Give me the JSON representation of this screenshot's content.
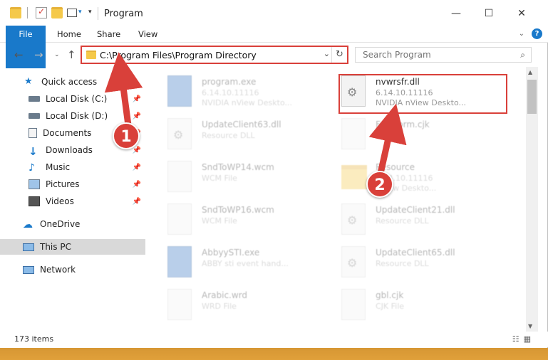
{
  "window": {
    "title": "Program"
  },
  "ribbon": {
    "tabs": [
      "File",
      "Home",
      "Share",
      "View"
    ]
  },
  "address": {
    "path": "C:\\Program Files\\Program Directory"
  },
  "search": {
    "placeholder": "Search Program"
  },
  "nav": {
    "items": [
      {
        "label": "Quick access",
        "icon": "star-icon"
      },
      {
        "label": "Local Disk (C:)",
        "icon": "drive-icon",
        "pinned": true
      },
      {
        "label": "Local Disk (D:)",
        "icon": "drive-icon",
        "pinned": true
      },
      {
        "label": "Documents",
        "icon": "documents-icon",
        "pinned": true
      },
      {
        "label": "Downloads",
        "icon": "downloads-icon",
        "pinned": true
      },
      {
        "label": "Music",
        "icon": "music-icon",
        "pinned": true
      },
      {
        "label": "Pictures",
        "icon": "pictures-icon",
        "pinned": true
      },
      {
        "label": "Videos",
        "icon": "videos-icon",
        "pinned": true
      },
      {
        "label": "OneDrive",
        "icon": "cloud-icon"
      },
      {
        "label": "This PC",
        "icon": "computer-icon",
        "selected": true
      },
      {
        "label": "Network",
        "icon": "network-icon"
      }
    ]
  },
  "files": [
    {
      "name": "program.exe",
      "line2": "6.14.10.11116",
      "line3": "NVIDIA nView Deskto...",
      "icon": "exe-icon",
      "faded": true
    },
    {
      "name": "nvwrsfr.dll",
      "line2": "6.14.10.11116",
      "line3": "NVIDIA nView Deskto...",
      "icon": "dll-gear-icon",
      "faded": false
    },
    {
      "name": "UpdateClient63.dll",
      "line2": "Resource DLL",
      "line3": "",
      "icon": "dll-gear-icon",
      "faded": true
    },
    {
      "name": "Fakeform.cjk",
      "line2": "",
      "line3": "",
      "icon": "file-icon",
      "faded": true
    },
    {
      "name": "SndToWP14.wcm",
      "line2": "WCM File",
      "line3": "",
      "icon": "file-icon",
      "faded": true
    },
    {
      "name": "Resource",
      "line2": "6.14.10.11116",
      "line3": "nView Deskto...",
      "icon": "folder-icon",
      "faded": true
    },
    {
      "name": "SndToWP16.wcm",
      "line2": "WCM File",
      "line3": "",
      "icon": "file-icon",
      "faded": true
    },
    {
      "name": "UpdateClient21.dll",
      "line2": "Resource DLL",
      "line3": "",
      "icon": "dll-gear-icon",
      "faded": true
    },
    {
      "name": "AbbyySTI.exe",
      "line2": "ABBY sti event hand...",
      "line3": "",
      "icon": "exe-icon",
      "faded": true
    },
    {
      "name": "UpdateClient65.dll",
      "line2": "Resource DLL",
      "line3": "",
      "icon": "dll-gear-icon",
      "faded": true
    },
    {
      "name": "Arabic.wrd",
      "line2": "WRD File",
      "line3": "",
      "icon": "file-icon",
      "faded": true
    },
    {
      "name": "gbl.cjk",
      "line2": "CJK File",
      "line3": "",
      "icon": "file-icon",
      "faded": true
    }
  ],
  "status": {
    "count": "173 items"
  },
  "annotations": {
    "step1": "1",
    "step2": "2",
    "color": "#d9403a"
  }
}
